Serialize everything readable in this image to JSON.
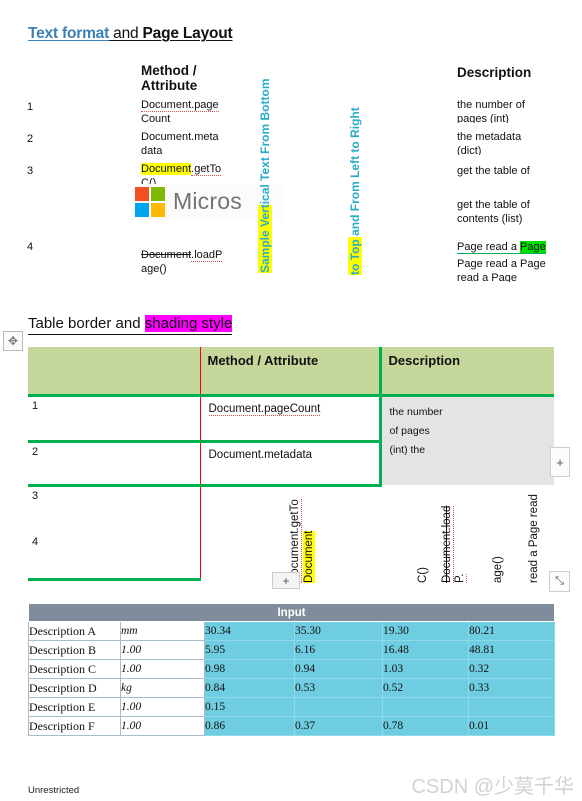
{
  "section1": {
    "heading": {
      "part_blue": "Text format",
      "part_and": " and ",
      "part_black": "Page Layout"
    },
    "columns": {
      "method": "Method / Attribute",
      "description": "Description"
    },
    "vertical_labels": {
      "left": "Sample Vertical Text From Bottom",
      "right": "to Top and From Left to Right"
    },
    "rows": [
      {
        "num": "1",
        "method_a": "Document.page",
        "method_b": "Count",
        "desc_a": "the number of",
        "desc_b": "pages (int)"
      },
      {
        "num": "2",
        "method_a": "Document.meta",
        "method_b": "data",
        "desc_a": "the metadata",
        "desc_b": "(dict)"
      },
      {
        "num": "3",
        "method_hl": "Document",
        "method_rest": ".getTo",
        "method_b": "C()",
        "desc_a": "get the table of",
        "desc_b": "",
        "desc_c": "get the table of",
        "desc_d": "contents (list)"
      },
      {
        "num": "4",
        "method_strike": "Document",
        "method_rest": ".loadP",
        "method_b": "age()",
        "desc_a": "Page read a ",
        "desc_hl": "Page",
        "desc_b": "Page read a Page",
        "desc_c": "read a Page"
      }
    ],
    "logo": {
      "word": "Micros",
      "squares": [
        "#f25022",
        "#7fba00",
        "#00a4ef",
        "#ffb900"
      ]
    }
  },
  "section2": {
    "heading": {
      "part_plain": "Table border and ",
      "part_highlight": "shading style"
    },
    "header": {
      "col0": "",
      "method": "Method / Attribute",
      "description": "Description"
    },
    "rows": [
      {
        "num": "1",
        "method": "Document.pageCount"
      },
      {
        "num": "2",
        "method": "Document.metadata"
      },
      {
        "num": "3",
        "method": ""
      },
      {
        "num": "4",
        "method": ""
      }
    ],
    "desc_lines": [
      "the number",
      "of pages",
      "(int) the"
    ],
    "vertical_cells": [
      {
        "text": "Document.getTo",
        "highlight": false
      },
      {
        "text": "Document",
        "highlight": true
      },
      {
        "text": "C()",
        "highlight": false
      },
      {
        "text": "Document.load",
        "highlight": false
      },
      {
        "text": "P.",
        "highlight": false
      },
      {
        "text": "age()",
        "highlight": false
      },
      {
        "text": "read a Page read",
        "highlight": false
      }
    ],
    "handles": {
      "move": "✥",
      "add_column": "+",
      "add_row": "+",
      "resize": "⤡"
    },
    "colors": {
      "header_fill": "#c5d79a",
      "border_green": "#00b050",
      "border_red": "#ff0000",
      "shade_gray": "#e4e4e4",
      "highlight_magenta": "#ff00ff",
      "highlight_yellow": "#ffff00"
    }
  },
  "section3": {
    "title": "Input",
    "rows": [
      {
        "label": "Description A",
        "unit": "mm",
        "values": [
          "30.34",
          "35.30",
          "19.30",
          "80.21"
        ]
      },
      {
        "label": "Description B",
        "unit": "1.00",
        "values": [
          "5.95",
          "6.16",
          "16.48",
          "48.81"
        ]
      },
      {
        "label": "Description C",
        "unit": "1.00",
        "values": [
          "0.98",
          "0.94",
          "1.03",
          "0.32"
        ]
      },
      {
        "label": "Description D",
        "unit": "kg",
        "values": [
          "0.84",
          "0.53",
          "0.52",
          "0.33"
        ]
      },
      {
        "label": "Description E",
        "unit": "1.00",
        "values": [
          "0.15",
          "",
          "",
          ""
        ]
      },
      {
        "label": "Description F",
        "unit": "1.00",
        "values": [
          "0.86",
          "0.37",
          "0.78",
          "0.01"
        ]
      }
    ],
    "colors": {
      "title_fill": "#7f8c9b",
      "value_fill": "#6ecde0"
    }
  },
  "footer": {
    "classification": "Unrestricted",
    "watermark": "CSDN @少莫千华"
  }
}
